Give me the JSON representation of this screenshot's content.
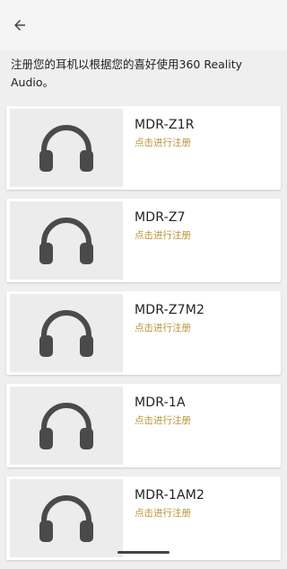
{
  "header": {
    "back_icon": "arrow-left-icon"
  },
  "intro_text": "注册您的耳机以根据您的喜好使用360 Reality Audio。",
  "colors": {
    "accent": "#b8953a",
    "icon": "#4a4a4a",
    "thumb_bg": "#ececec"
  },
  "devices": [
    {
      "name": "MDR-Z1R",
      "action": "点击进行注册",
      "icon": "headphones-icon"
    },
    {
      "name": "MDR-Z7",
      "action": "点击进行注册",
      "icon": "headphones-icon"
    },
    {
      "name": "MDR-Z7M2",
      "action": "点击进行注册",
      "icon": "headphones-icon"
    },
    {
      "name": "MDR-1A",
      "action": "点击进行注册",
      "icon": "headphones-icon"
    },
    {
      "name": "MDR-1AM2",
      "action": "点击进行注册",
      "icon": "headphones-icon"
    }
  ]
}
